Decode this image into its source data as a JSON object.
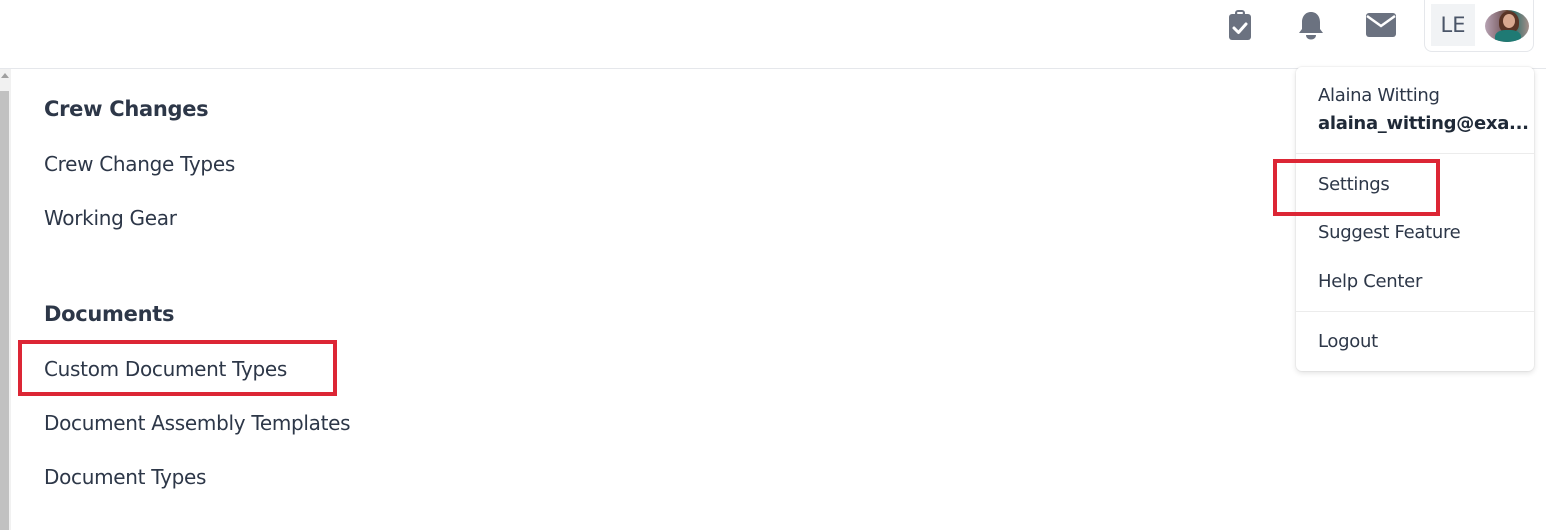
{
  "header": {
    "icons": [
      {
        "name": "clipboard-check-icon",
        "label": "Tasks"
      },
      {
        "name": "bell-icon",
        "label": "Notifications"
      },
      {
        "name": "envelope-icon",
        "label": "Messages"
      }
    ],
    "user_initials": "LE",
    "icon_color": "#6b7280"
  },
  "main": {
    "sections": [
      {
        "title": "Crew Changes",
        "items": [
          "Crew Change Types",
          "Working Gear"
        ]
      },
      {
        "title": "Documents",
        "items": [
          "Custom Document Types",
          "Document Assembly Templates",
          "Document Types"
        ]
      }
    ]
  },
  "user_menu": {
    "name": "Alaina Witting",
    "email": "alaina_witting@exa...",
    "items": [
      "Settings",
      "Suggest Feature",
      "Help Center"
    ],
    "logout": "Logout"
  },
  "annotations": {
    "highlight_color": "#dc2635",
    "highlighted": [
      "Custom Document Types",
      "Settings"
    ]
  }
}
